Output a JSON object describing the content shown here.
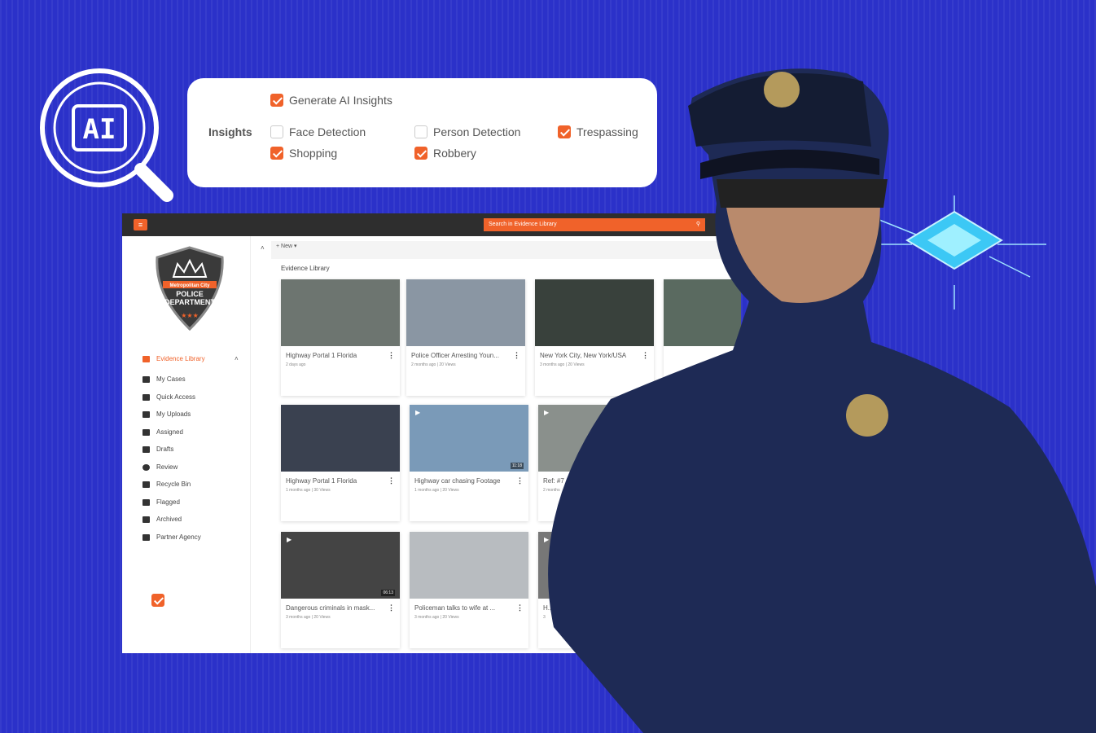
{
  "insights": {
    "label": "Insights",
    "generate": {
      "label": "Generate AI Insights",
      "checked": true
    },
    "options": [
      {
        "label": "Face Detection",
        "checked": false
      },
      {
        "label": "Person Detection",
        "checked": false
      },
      {
        "label": "Trespassing",
        "checked": true
      },
      {
        "label": "Shopping",
        "checked": true
      },
      {
        "label": "Robbery",
        "checked": true
      }
    ]
  },
  "ai_badge": "AI",
  "app": {
    "search_placeholder": "Search in Evidence Library",
    "new_label": "New",
    "section_title": "Evidence Library",
    "logo": {
      "top": "Metropolitan City",
      "line1": "POLICE",
      "line2": "DEPARTMENT"
    },
    "nav": [
      {
        "label": "Evidence Library",
        "active": true
      },
      {
        "label": "My Cases"
      },
      {
        "label": "Quick Access"
      },
      {
        "label": "My Uploads"
      },
      {
        "label": "Assigned"
      },
      {
        "label": "Drafts"
      },
      {
        "label": "Review"
      },
      {
        "label": "Recycle Bin"
      },
      {
        "label": "Flagged"
      },
      {
        "label": "Archived"
      },
      {
        "label": "Partner Agency"
      }
    ],
    "cards": [
      {
        "title": "Highway Portal 1 Florida",
        "meta": "2 days ago",
        "color": "#6d7570"
      },
      {
        "title": "Police Officer Arresting Youn...",
        "meta": "2 months ago | 20 Views",
        "color": "#8a96a3"
      },
      {
        "title": "New York City, New York/USA",
        "meta": "3 months ago | 20 Views",
        "color": "#39413c"
      },
      {
        "title": "",
        "meta": "",
        "color": "#5a6a60"
      },
      {
        "title": "Highway Portal 1 Florida",
        "meta": "1 months ago | 30 Views",
        "color": "#3a4150"
      },
      {
        "title": "Highway car chasing Footage",
        "meta": "1 months ago | 20 Views",
        "color": "#7a9ab8",
        "duration": "11:18"
      },
      {
        "title": "Ref: #7",
        "meta": "2 months",
        "color": "#8a908c"
      },
      {
        "title": "Dangerous criminals in mask...",
        "meta": "3 months ago | 20 Views",
        "color": "#444",
        "duration": "06:13"
      },
      {
        "title": "Policeman talks to wife at ...",
        "meta": "3 months ago | 20 Views",
        "color": "#b8bcc0"
      },
      {
        "title": "H...469",
        "meta": "3",
        "color": "#777"
      }
    ]
  },
  "colors": {
    "accent": "#f0622a",
    "background": "#2b31c9",
    "topbar": "#2e2e2e"
  }
}
